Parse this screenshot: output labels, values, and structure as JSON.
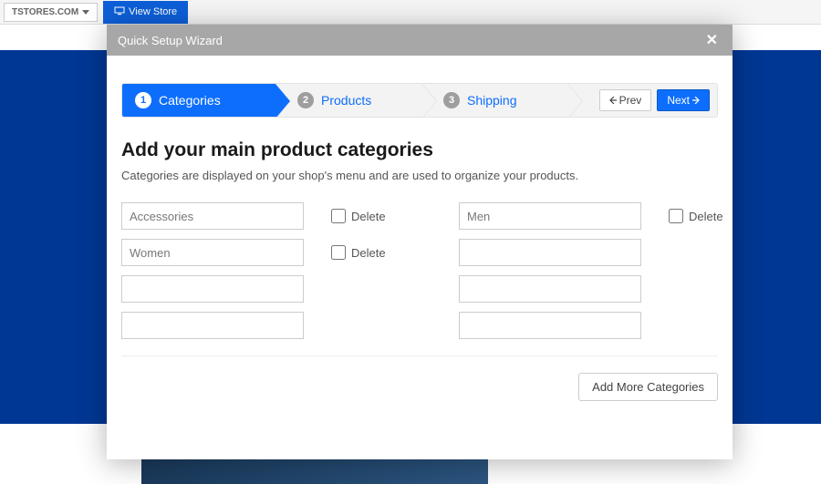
{
  "topbar": {
    "stores_label": "TSTORES.COM",
    "view_store_label": "View Store"
  },
  "modal": {
    "title": "Quick Setup Wizard",
    "steps": [
      {
        "num": "1",
        "label": "Categories"
      },
      {
        "num": "2",
        "label": "Products"
      },
      {
        "num": "3",
        "label": "Shipping"
      }
    ],
    "nav": {
      "prev_label": "Prev",
      "next_label": "Next"
    },
    "heading": "Add your main product categories",
    "subtext": "Categories are displayed on your shop's menu and are used to organize your products.",
    "delete_label": "Delete",
    "categories": {
      "left": [
        "Accessories",
        "Women",
        "",
        ""
      ],
      "right": [
        "Men",
        "",
        "",
        ""
      ]
    },
    "add_more_label": "Add More Categories"
  }
}
